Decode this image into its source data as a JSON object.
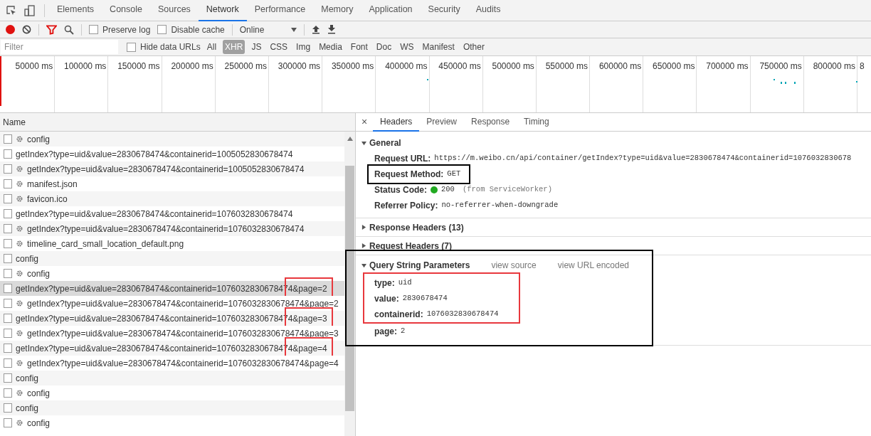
{
  "panel_tabs": [
    {
      "label": "Elements",
      "selected": false
    },
    {
      "label": "Console",
      "selected": false
    },
    {
      "label": "Sources",
      "selected": false
    },
    {
      "label": "Network",
      "selected": true
    },
    {
      "label": "Performance",
      "selected": false
    },
    {
      "label": "Memory",
      "selected": false
    },
    {
      "label": "Application",
      "selected": false
    },
    {
      "label": "Security",
      "selected": false
    },
    {
      "label": "Audits",
      "selected": false
    }
  ],
  "toolbar": {
    "recording": true,
    "preserve_log": {
      "label": "Preserve log",
      "checked": false
    },
    "disable_cache": {
      "label": "Disable cache",
      "checked": false
    },
    "throttling": "Online"
  },
  "filter_bar": {
    "placeholder": "Filter",
    "hide_data_urls": {
      "label": "Hide data URLs",
      "checked": false
    },
    "types": [
      {
        "label": "All",
        "selected": false
      },
      {
        "label": "XHR",
        "selected": true
      },
      {
        "label": "JS",
        "selected": false
      },
      {
        "label": "CSS",
        "selected": false
      },
      {
        "label": "Img",
        "selected": false
      },
      {
        "label": "Media",
        "selected": false
      },
      {
        "label": "Font",
        "selected": false
      },
      {
        "label": "Doc",
        "selected": false
      },
      {
        "label": "WS",
        "selected": false
      },
      {
        "label": "Manifest",
        "selected": false
      },
      {
        "label": "Other",
        "selected": false
      }
    ]
  },
  "timeline": {
    "ticks": [
      "50000 ms",
      "100000 ms",
      "150000 ms",
      "200000 ms",
      "250000 ms",
      "300000 ms",
      "350000 ms",
      "400000 ms",
      "450000 ms",
      "500000 ms",
      "550000 ms",
      "600000 ms",
      "650000 ms",
      "700000 ms",
      "750000 ms",
      "800000 ms",
      "8"
    ]
  },
  "requests": {
    "column": "Name",
    "rows": [
      {
        "name": "config",
        "kind": "worker",
        "selected": false,
        "boxed": false
      },
      {
        "name": "getIndex?type=uid&value=2830678474&containerid=1005052830678474",
        "kind": "plain",
        "selected": false,
        "boxed": false
      },
      {
        "name": "getIndex?type=uid&value=2830678474&containerid=1005052830678474",
        "kind": "worker",
        "selected": false,
        "boxed": false
      },
      {
        "name": "manifest.json",
        "kind": "worker",
        "selected": false,
        "boxed": false
      },
      {
        "name": "favicon.ico",
        "kind": "worker",
        "selected": false,
        "boxed": false
      },
      {
        "name": "getIndex?type=uid&value=2830678474&containerid=1076032830678474",
        "kind": "plain",
        "selected": false,
        "boxed": false
      },
      {
        "name": "getIndex?type=uid&value=2830678474&containerid=1076032830678474",
        "kind": "worker",
        "selected": false,
        "boxed": false
      },
      {
        "name": "timeline_card_small_location_default.png",
        "kind": "worker",
        "selected": false,
        "boxed": false
      },
      {
        "name": "config",
        "kind": "plain",
        "selected": false,
        "boxed": false
      },
      {
        "name": "config",
        "kind": "worker",
        "selected": false,
        "boxed": false
      },
      {
        "name": "getIndex?type=uid&value=2830678474&containerid=1076032830678474&page=2",
        "kind": "plain",
        "selected": true,
        "boxed": true
      },
      {
        "name": "getIndex?type=uid&value=2830678474&containerid=1076032830678474&page=2",
        "kind": "worker",
        "selected": false,
        "boxed": false
      },
      {
        "name": "getIndex?type=uid&value=2830678474&containerid=1076032830678474&page=3",
        "kind": "plain",
        "selected": false,
        "boxed": true
      },
      {
        "name": "getIndex?type=uid&value=2830678474&containerid=1076032830678474&page=3",
        "kind": "worker",
        "selected": false,
        "boxed": false
      },
      {
        "name": "getIndex?type=uid&value=2830678474&containerid=1076032830678474&page=4",
        "kind": "plain",
        "selected": false,
        "boxed": true
      },
      {
        "name": "getIndex?type=uid&value=2830678474&containerid=1076032830678474&page=4",
        "kind": "worker",
        "selected": false,
        "boxed": false
      },
      {
        "name": "config",
        "kind": "plain",
        "selected": false,
        "boxed": false
      },
      {
        "name": "config",
        "kind": "worker",
        "selected": false,
        "boxed": false
      },
      {
        "name": "config",
        "kind": "plain",
        "selected": false,
        "boxed": false
      },
      {
        "name": "config",
        "kind": "worker",
        "selected": false,
        "boxed": false
      }
    ]
  },
  "details": {
    "close": "×",
    "tabs": [
      {
        "label": "Headers",
        "selected": true
      },
      {
        "label": "Preview",
        "selected": false
      },
      {
        "label": "Response",
        "selected": false
      },
      {
        "label": "Timing",
        "selected": false
      }
    ],
    "general": {
      "title": "General",
      "expanded": true,
      "fields": [
        {
          "key": "Request URL:",
          "value": "https://m.weibo.cn/api/container/getIndex?type=uid&value=2830678474&containerid=1076032830678",
          "kind": "text",
          "boxed": false
        },
        {
          "key": "Request Method:",
          "value": "GET",
          "kind": "text",
          "boxed": true
        },
        {
          "key": "Status Code:",
          "value": "200",
          "note": "(from ServiceWorker)",
          "kind": "status",
          "boxed": false
        },
        {
          "key": "Referrer Policy:",
          "value": "no-referrer-when-downgrade",
          "kind": "text",
          "boxed": false
        }
      ]
    },
    "response_headers": {
      "title": "Response Headers (13)",
      "expanded": false
    },
    "request_headers": {
      "title": "Request Headers (7)",
      "expanded": false
    },
    "query": {
      "title": "Query String Parameters",
      "expanded": true,
      "boxed": true,
      "links": [
        "view source",
        "view URL encoded"
      ],
      "boxed_params": [
        {
          "key": "type:",
          "value": "uid"
        },
        {
          "key": "value:",
          "value": "2830678474"
        },
        {
          "key": "containerid:",
          "value": "1076032830678474"
        }
      ],
      "params": [
        {
          "key": "page:",
          "value": "2"
        }
      ]
    }
  }
}
